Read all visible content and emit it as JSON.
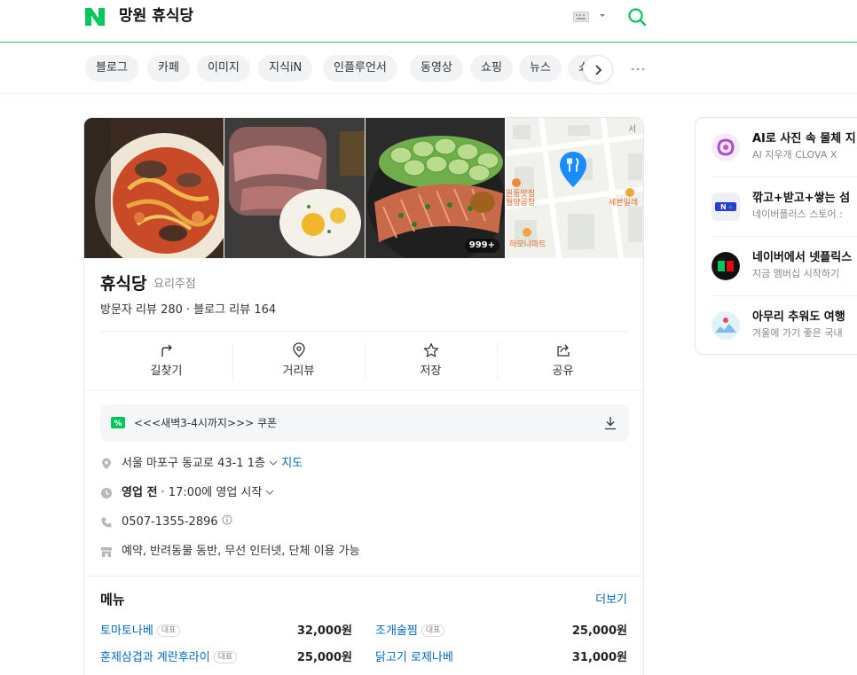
{
  "header": {
    "logo_letter": "N",
    "query": "망원 휴식당"
  },
  "tabs": [
    "블로그",
    "카페",
    "이미지",
    "지식iN",
    "인플루언서",
    "동영상",
    "쇼핑",
    "뉴스",
    "쇼"
  ],
  "place": {
    "photo_count": "999+",
    "map_labels": [
      "원동맛집",
      "월양곱창",
      "세븐일레",
      "하모니마트",
      "서"
    ],
    "name": "휴식당",
    "category": "요리주점",
    "reviews": "방문자 리뷰 280 · 블로그 리뷰 164",
    "actions": [
      {
        "label": "길찾기",
        "icon": "directions-icon"
      },
      {
        "label": "거리뷰",
        "icon": "streetview-icon"
      },
      {
        "label": "저장",
        "icon": "star-icon"
      },
      {
        "label": "공유",
        "icon": "share-icon"
      }
    ],
    "coupon": {
      "badge": "%",
      "text": "<<<새벽3-4시까지>>> 쿠폰"
    },
    "address": "서울 마포구 동교로 43-1 1층",
    "address_map_link": "지도",
    "hours_status": "영업 전",
    "hours_detail": "· 17:00에 영업 시작",
    "phone": "0507-1355-2896",
    "amenities": "예약, 반려동물 동반, 무선 인터넷, 단체 이용 가능"
  },
  "menu": {
    "title": "메뉴",
    "more": "더보기",
    "badge": "대표",
    "items": [
      {
        "name": "토마토나베",
        "price": "32,000원"
      },
      {
        "name": "조개술찜",
        "price": "25,000원"
      },
      {
        "name": "훈제삼겹과 계란후라이",
        "price": "25,000원"
      },
      {
        "name": "닭고기 로제나베",
        "price": "31,000원"
      }
    ]
  },
  "side": {
    "items": [
      {
        "title": "AI로 사진 속 물체 지",
        "subtitle": "AI 지우개 CLOVA X",
        "icon": "clova-icon"
      },
      {
        "title": "깎고+받고+쌓는 섬",
        "subtitle": "네이버플러스 스토어 :",
        "icon": "naverplus-icon"
      },
      {
        "title": "네이버에서 넷플릭스",
        "subtitle": "지금 멤버십 시작하기",
        "icon": "netflix-icon"
      },
      {
        "title": "아무리 추워도 여행",
        "subtitle": "겨울에 가기 좋은 국내",
        "icon": "travel-icon"
      }
    ]
  },
  "colors": {
    "brand_green": "#03c75a",
    "link_blue": "#0068c3",
    "map_pin": "#1a8cff"
  }
}
